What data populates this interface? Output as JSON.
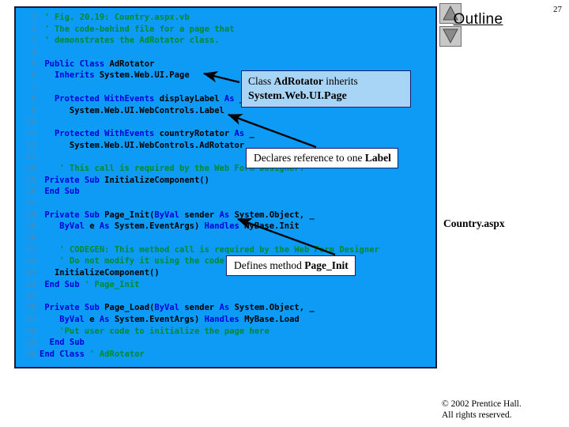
{
  "header": {
    "outline_title": "Outline",
    "page_number": "27",
    "nav_up_icon": "triangle-up-icon",
    "nav_down_icon": "triangle-down-icon"
  },
  "file_label": "Country.aspx",
  "footer": {
    "line1": "© 2002 Prentice Hall.",
    "line2": "All rights reserved."
  },
  "colors": {
    "code_background": "#0d9bf5",
    "keyword": "#0000d8",
    "comment": "#008a2e",
    "identifier": "#000000",
    "line_number": "#3d8fc4",
    "callout_fill_blue": "#a8d4f5",
    "callout_fill_white": "#ffffff",
    "callout_border": "#1c1c6e"
  },
  "code": {
    "lines": [
      {
        "n": "1",
        "tokens": [
          {
            "t": "cm",
            "s": "' Fig. 20.19: Country.aspx.vb"
          }
        ],
        "indent": 1
      },
      {
        "n": "2",
        "tokens": [
          {
            "t": "cm",
            "s": "' The code-behind file for a page that"
          }
        ],
        "indent": 1
      },
      {
        "n": "3",
        "tokens": [
          {
            "t": "cm",
            "s": "' demonstrates the AdRotator class."
          }
        ],
        "indent": 1
      },
      {
        "n": "4",
        "tokens": [],
        "indent": 0
      },
      {
        "n": "5",
        "tokens": [
          {
            "t": "kw",
            "s": "Public Class "
          },
          {
            "t": "id",
            "s": "AdRotator"
          }
        ],
        "indent": 1
      },
      {
        "n": "6",
        "tokens": [
          {
            "t": "kw",
            "s": "Inherits "
          },
          {
            "t": "id",
            "s": "System.Web.UI.Page"
          }
        ],
        "indent": 3
      },
      {
        "n": "7",
        "tokens": [],
        "indent": 0
      },
      {
        "n": "8",
        "tokens": [
          {
            "t": "kw",
            "s": "Protected WithEvents "
          },
          {
            "t": "id",
            "s": "displayLabel "
          },
          {
            "t": "kw",
            "s": "As "
          },
          {
            "t": "id",
            "s": "_"
          }
        ],
        "indent": 3
      },
      {
        "n": "9",
        "tokens": [
          {
            "t": "id",
            "s": "System.Web.UI.WebControls.Label"
          }
        ],
        "indent": 6
      },
      {
        "n": "10",
        "tokens": [],
        "indent": 0
      },
      {
        "n": "11",
        "tokens": [
          {
            "t": "kw",
            "s": "Protected WithEvents "
          },
          {
            "t": "id",
            "s": "countryRotator "
          },
          {
            "t": "kw",
            "s": "As "
          },
          {
            "t": "id",
            "s": "_"
          }
        ],
        "indent": 3
      },
      {
        "n": "12",
        "tokens": [
          {
            "t": "id",
            "s": "System.Web.UI.WebControls.AdRotator"
          }
        ],
        "indent": 6
      },
      {
        "n": "13",
        "tokens": [],
        "indent": 0
      },
      {
        "n": "14",
        "tokens": [
          {
            "t": "cm",
            "s": "' This call is required by the Web Form Designer."
          }
        ],
        "indent": 4
      },
      {
        "n": "15",
        "tokens": [
          {
            "t": "kw",
            "s": "Private Sub "
          },
          {
            "t": "id",
            "s": "InitializeComponent()"
          }
        ],
        "indent": 1
      },
      {
        "n": "16",
        "tokens": [
          {
            "t": "kw",
            "s": "End Sub"
          }
        ],
        "indent": 1
      },
      {
        "n": "17",
        "tokens": [],
        "indent": 0
      },
      {
        "n": "18",
        "tokens": [
          {
            "t": "kw",
            "s": "Private Sub "
          },
          {
            "t": "id",
            "s": "Page_Init("
          },
          {
            "t": "kw",
            "s": "ByVal "
          },
          {
            "t": "id",
            "s": "sender "
          },
          {
            "t": "kw",
            "s": "As "
          },
          {
            "t": "id",
            "s": "System.Object, _"
          }
        ],
        "indent": 1
      },
      {
        "n": "19",
        "tokens": [
          {
            "t": "kw",
            "s": "ByVal "
          },
          {
            "t": "id",
            "s": "e "
          },
          {
            "t": "kw",
            "s": "As "
          },
          {
            "t": "id",
            "s": "System.EventArgs) "
          },
          {
            "t": "kw",
            "s": "Handles "
          },
          {
            "t": "id",
            "s": "MyBase.Init"
          }
        ],
        "indent": 4
      },
      {
        "n": "20",
        "tokens": [],
        "indent": 0
      },
      {
        "n": "21",
        "tokens": [
          {
            "t": "cm",
            "s": "' CODEGEN: This method call is required by the Web Form Designer"
          }
        ],
        "indent": 4
      },
      {
        "n": "22",
        "tokens": [
          {
            "t": "cm",
            "s": "' Do not modify it using the code editor."
          }
        ],
        "indent": 4
      },
      {
        "n": "23",
        "tokens": [
          {
            "t": "id",
            "s": "InitializeComponent()"
          }
        ],
        "indent": 3
      },
      {
        "n": "24",
        "tokens": [
          {
            "t": "kw",
            "s": "End Sub "
          },
          {
            "t": "cm",
            "s": "' Page_Init"
          }
        ],
        "indent": 1
      },
      {
        "n": "25",
        "tokens": [],
        "indent": 0
      },
      {
        "n": "26",
        "tokens": [
          {
            "t": "kw",
            "s": "Private Sub "
          },
          {
            "t": "id",
            "s": "Page_Load("
          },
          {
            "t": "kw",
            "s": "ByVal "
          },
          {
            "t": "id",
            "s": "sender "
          },
          {
            "t": "kw",
            "s": "As "
          },
          {
            "t": "id",
            "s": "System.Object, _"
          }
        ],
        "indent": 1
      },
      {
        "n": "27",
        "tokens": [
          {
            "t": "kw",
            "s": "ByVal "
          },
          {
            "t": "id",
            "s": "e "
          },
          {
            "t": "kw",
            "s": "As "
          },
          {
            "t": "id",
            "s": "System.EventArgs) "
          },
          {
            "t": "kw",
            "s": "Handles "
          },
          {
            "t": "id",
            "s": "MyBase.Load"
          }
        ],
        "indent": 4
      },
      {
        "n": "28",
        "tokens": [
          {
            "t": "cm",
            "s": "'Put user code to initialize the page here"
          }
        ],
        "indent": 4
      },
      {
        "n": "29",
        "tokens": [
          {
            "t": "kw",
            "s": "End Sub"
          }
        ],
        "indent": 2
      },
      {
        "n": "30",
        "tokens": [
          {
            "t": "kw",
            "s": "End Class "
          },
          {
            "t": "cm",
            "s": "' AdRotator"
          }
        ],
        "indent": 0
      }
    ]
  },
  "callouts": {
    "one": {
      "line1_pre": "Class ",
      "line1_bold": "AdRotator",
      "line1_post": " inherits",
      "line2": "System.Web.UI.Page"
    },
    "two": {
      "pre": "Declares reference to one ",
      "bold": "Label"
    },
    "three": {
      "pre": "Defines method ",
      "bold": "Page_Init"
    }
  }
}
